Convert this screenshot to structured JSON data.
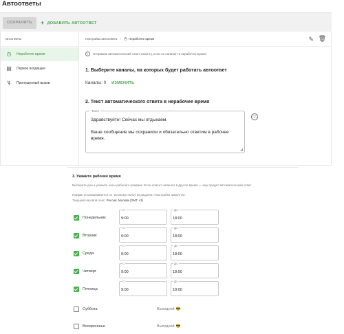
{
  "page": {
    "title": "Автоответы"
  },
  "toolbar": {
    "save_label": "СОХРАНИТЬ",
    "add_label": "ДОБАВИТЬ АВТООТВЕТ",
    "add_plus": "+"
  },
  "sidebar": {
    "header": "Автоответы",
    "items": [
      {
        "label": "Нерабочее время",
        "icon": "clock-icon",
        "glyph": "◷",
        "active": true
      },
      {
        "label": "Первое входящее",
        "icon": "message-icon",
        "glyph": "▤",
        "active": false
      },
      {
        "label": "Пропущенный вызов",
        "icon": "missed-call-icon",
        "glyph": "↯",
        "active": false
      }
    ]
  },
  "main": {
    "breadcrumb_root": "Настройки автоответа",
    "breadcrumb_sep": "›",
    "breadcrumb_current": "Нерабочее время",
    "info_text": "Отправим автоматический ответ клиенту, если он напишет в нерабочее время.",
    "section1_title": "1. Выберите каналы, на которых будет работать автоответ",
    "channels_label": "Каналы: 0",
    "change_label": "ИЗМЕНИТЬ",
    "section2_title": "2. Текст автоматического ответа в нерабочее время",
    "textarea_label": "Текст",
    "textarea_line1": "Здравствуйте! Сейчас мы отдыхаем.",
    "textarea_line2": "Ваше сообщение мы сохранили и обязательно ответим в рабочее время."
  },
  "schedule": {
    "title": "3. Укажите рабочее время",
    "subtitle": "Выберите дни и укажите часы рабочего графика. Если клиент напишет в другое время — ему придет автоматический ответ.",
    "note": "График устанавливается по часовому поясу из раздела «Настройки аккаунта».",
    "tz_label": "Текущий часовой пояс:",
    "tz_value": "Россия, Москва (GMT +3)",
    "from_label": "С",
    "to_label": "До",
    "dayoff_label": "Выходной",
    "dayoff_emoji": "😎",
    "days": [
      {
        "name": "Понедельник",
        "checked": true,
        "from": "9:00",
        "to": "18:00"
      },
      {
        "name": "Вторник",
        "checked": true,
        "from": "9:00",
        "to": "18:00"
      },
      {
        "name": "Среда",
        "checked": true,
        "from": "9:00",
        "to": "18:00"
      },
      {
        "name": "Четверг",
        "checked": true,
        "from": "9:00",
        "to": "18:00"
      },
      {
        "name": "Пятница",
        "checked": true,
        "from": "9:00",
        "to": "18:00"
      },
      {
        "name": "Суббота",
        "checked": false
      },
      {
        "name": "Воскресенье",
        "checked": false
      }
    ]
  },
  "colors": {
    "accent": "#46a84b",
    "active_bg": "#e8f5e9"
  }
}
